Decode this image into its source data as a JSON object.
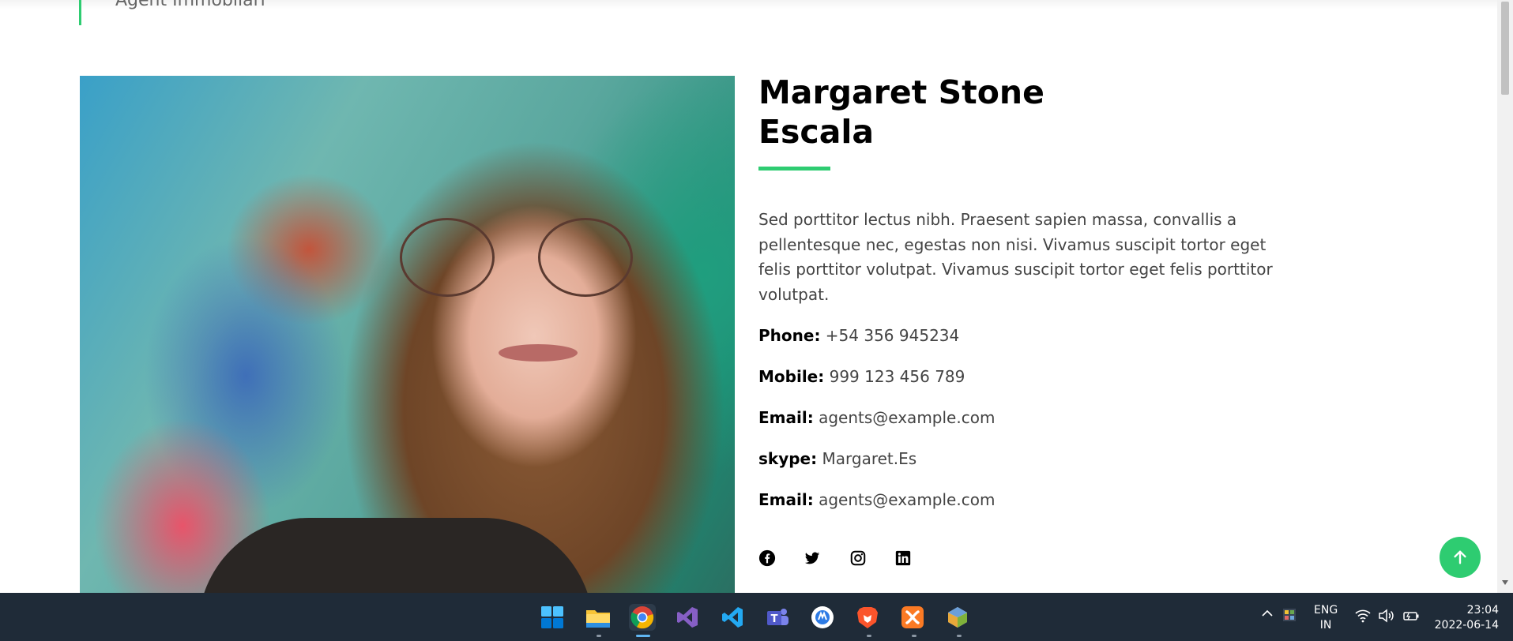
{
  "subtitle": "Agent Immobilari",
  "agent": {
    "name_line1": "Margaret Stone",
    "name_line2": "Escala",
    "bio": "Sed porttitor lectus nibh. Praesent sapien massa, convallis a pellentesque nec, egestas non nisi. Vivamus suscipit tortor eget felis porttitor volutpat. Vivamus suscipit tortor eget felis porttitor volutpat.",
    "contacts": [
      {
        "label": "Phone:",
        "value": "+54 356 945234"
      },
      {
        "label": "Mobile:",
        "value": "999 123 456 789"
      },
      {
        "label": "Email:",
        "value": "agents@example.com"
      },
      {
        "label": "skype:",
        "value": "Margaret.Es"
      },
      {
        "label": "Email:",
        "value": "agents@example.com"
      }
    ],
    "social": [
      "facebook-icon",
      "twitter-icon",
      "instagram-icon",
      "linkedin-icon"
    ]
  },
  "colors": {
    "accent": "#2ecc71",
    "taskbar": "#1f2b38"
  },
  "taskbar": {
    "apps": [
      "windows-start-icon",
      "file-explorer-icon",
      "chrome-icon",
      "visual-studio-icon",
      "vscode-icon",
      "teams-icon",
      "app-icon",
      "brave-icon",
      "xampp-icon",
      "app-cube-icon"
    ],
    "lang_line1": "ENG",
    "lang_line2": "IN",
    "time": "23:04",
    "date": "2022-06-14"
  }
}
